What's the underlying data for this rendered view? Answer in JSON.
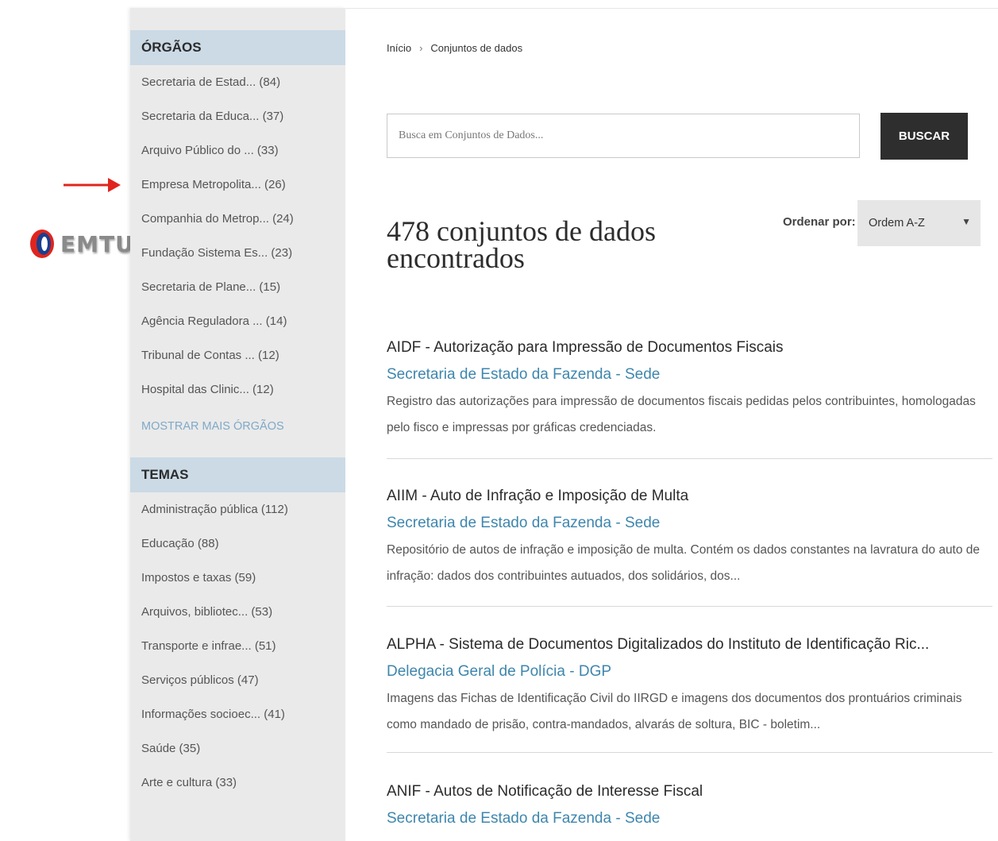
{
  "logo": {
    "text": "EMTU"
  },
  "sidebar": {
    "orgaos": {
      "heading": "ÓRGÃOS",
      "items": [
        "Secretaria de Estad... (84)",
        "Secretaria da Educa... (37)",
        "Arquivo Público do ... (33)",
        "Empresa Metropolita... (26)",
        "Companhia do Metrop... (24)",
        "Fundação Sistema Es... (23)",
        "Secretaria de Plane... (15)",
        "Agência Reguladora ... (14)",
        "Tribunal de Contas ... (12)",
        "Hospital das Clinic... (12)"
      ],
      "show_more": "MOSTRAR MAIS ÓRGÃOS"
    },
    "temas": {
      "heading": "TEMAS",
      "items": [
        "Administração pública (112)",
        "Educação (88)",
        "Impostos e taxas (59)",
        "Arquivos, bibliotec... (53)",
        "Transporte e infrae... (51)",
        "Serviços públicos (47)",
        "Informações socioec... (41)",
        "Saúde (35)",
        "Arte e cultura (33)"
      ]
    }
  },
  "breadcrumb": {
    "home": "Início",
    "separator": "›",
    "current": "Conjuntos de dados"
  },
  "search": {
    "placeholder": "Busca em Conjuntos de Dados...",
    "button": "BUSCAR"
  },
  "results": {
    "title": "478 conjuntos de dados encontrados"
  },
  "sort": {
    "label": "Ordenar por:",
    "selected": "Ordem A-Z"
  },
  "datasets": [
    {
      "title": "AIDF - Autorização para Impressão de Documentos Fiscais",
      "org": "Secretaria de Estado da Fazenda - Sede",
      "description": "Registro das autorizações para impressão de documentos fiscais pedidas pelos contribuintes, homologadas pelo fisco e impressas por gráficas credenciadas."
    },
    {
      "title": "AIIM - Auto de Infração e Imposição de Multa",
      "org": "Secretaria de Estado da Fazenda - Sede",
      "description": "Repositório de autos de infração e imposição de multa. Contém os dados constantes na lavratura do auto de infração: dados dos contribuintes autuados, dos solidários, dos..."
    },
    {
      "title": "ALPHA - Sistema de Documentos Digitalizados do Instituto de Identificação Ric...",
      "org": "Delegacia Geral de Polícia - DGP",
      "description": "Imagens das Fichas de Identificação Civil do IIRGD e imagens dos documentos dos prontuários criminais como mandado de prisão, contra-mandados, alvarás de soltura, BIC - boletim..."
    },
    {
      "title": "ANIF - Autos de Notificação de Interesse Fiscal",
      "org": "Secretaria de Estado da Fazenda - Sede",
      "description": ""
    }
  ],
  "colors": {
    "sidebar_bg": "#eaeaea",
    "sidebar_heading_bg": "#cbdae5",
    "link_blue": "#3e86ad",
    "button_dark": "#2e2e2e",
    "arrow_red": "#e0241e"
  }
}
